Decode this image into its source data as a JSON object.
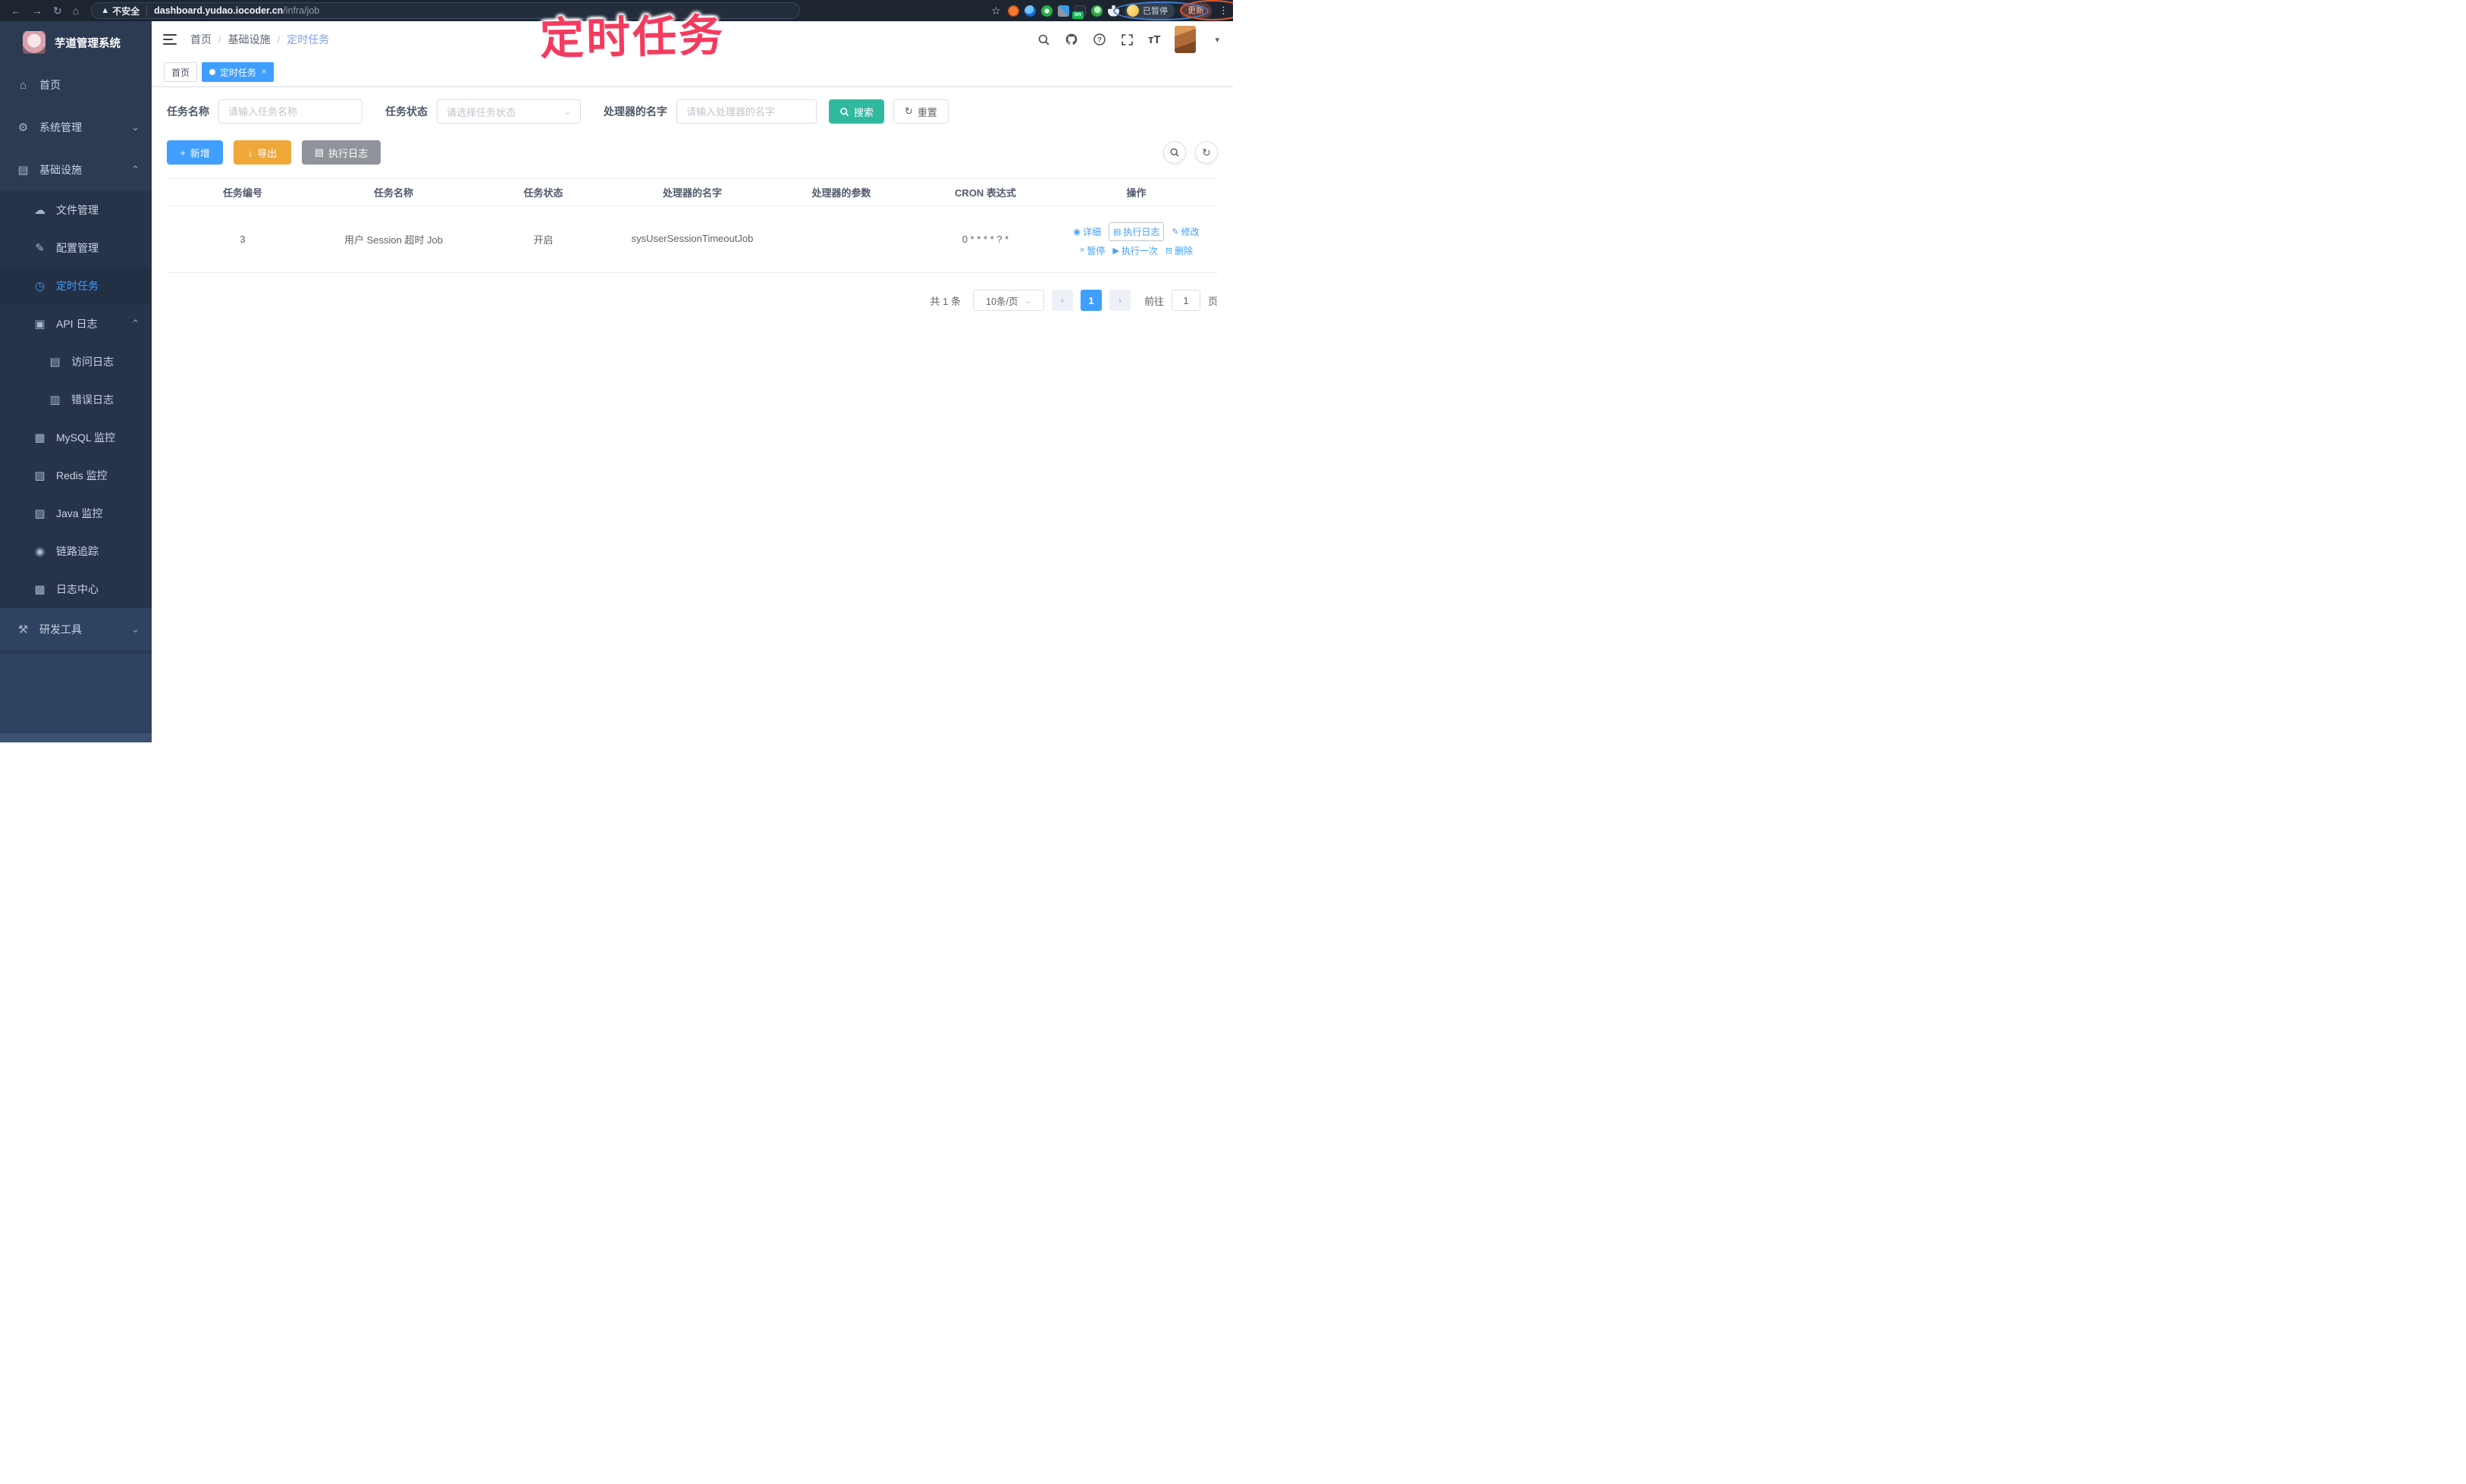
{
  "annotation": {
    "text": "定时任务",
    "color": "#f43b5f"
  },
  "browser": {
    "security_label": "不安全",
    "url_host": "dashboard.yudao.iocoder.cn",
    "url_path": "/infra/job",
    "profile_status": "已暂停",
    "update_button": "更新",
    "extension_on_badge": "on"
  },
  "sidebar": {
    "title": "芋道管理系统",
    "items": [
      {
        "label": "首页"
      },
      {
        "label": "系统管理"
      },
      {
        "label": "基础设施"
      },
      {
        "label": "文件管理"
      },
      {
        "label": "配置管理"
      },
      {
        "label": "定时任务"
      },
      {
        "label": "API 日志"
      },
      {
        "label": "访问日志"
      },
      {
        "label": "错误日志"
      },
      {
        "label": "MySQL 监控"
      },
      {
        "label": "Redis 监控"
      },
      {
        "label": "Java 监控"
      },
      {
        "label": "链路追踪"
      },
      {
        "label": "日志中心"
      },
      {
        "label": "研发工具"
      }
    ]
  },
  "header": {
    "breadcrumb": [
      {
        "label": "首页"
      },
      {
        "label": "基础设施"
      },
      {
        "label": "定时任务"
      }
    ]
  },
  "tabs": [
    {
      "label": "首页"
    },
    {
      "label": "定时任务"
    }
  ],
  "filters": {
    "name_label": "任务名称",
    "name_placeholder": "请输入任务名称",
    "status_label": "任务状态",
    "status_placeholder": "请选择任务状态",
    "handler_label": "处理器的名字",
    "handler_placeholder": "请输入处理器的名字",
    "search_label": "搜索",
    "reset_label": "重置"
  },
  "toolbar": {
    "add_label": "新增",
    "export_label": "导出",
    "log_label": "执行日志"
  },
  "table": {
    "headers": [
      "任务编号",
      "任务名称",
      "任务状态",
      "处理器的名字",
      "处理器的参数",
      "CRON 表达式",
      "操作"
    ],
    "row": {
      "id": "3",
      "name": "用户 Session 超时 Job",
      "status": "开启",
      "handler": "sysUserSessionTimeoutJob",
      "param": "",
      "cron": "0 * * * * ? *"
    },
    "ops": [
      {
        "label": "详细"
      },
      {
        "label": "执行日志"
      },
      {
        "label": "修改"
      },
      {
        "label": "暂停"
      },
      {
        "label": "执行一次"
      },
      {
        "label": "删除"
      }
    ]
  },
  "pagination": {
    "total": "共 1 条",
    "page_size": "10条/页",
    "current_page": "1",
    "goto_label": "前往",
    "goto_value": "1",
    "unit_label": "页"
  }
}
